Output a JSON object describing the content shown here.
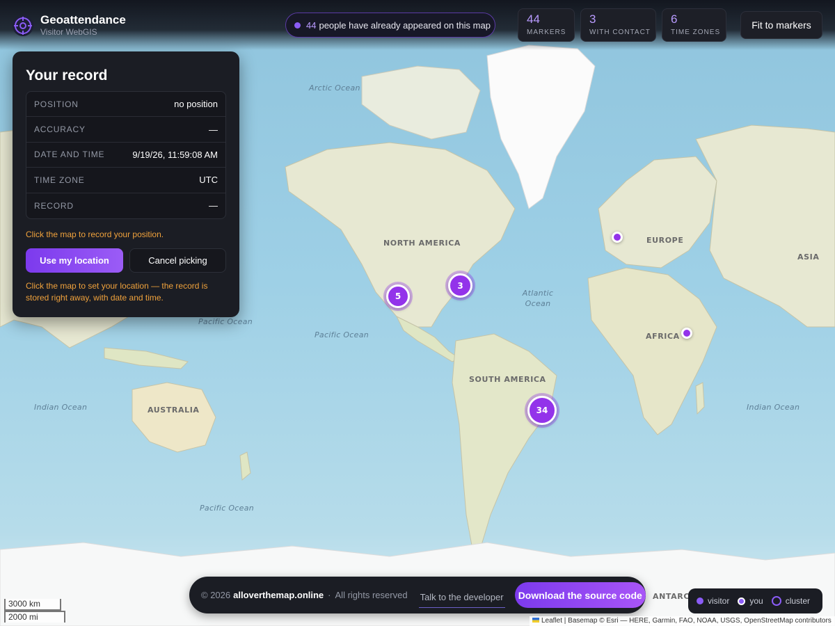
{
  "header": {
    "title": "Geoattendance",
    "subtitle": "Visitor WebGIS",
    "appeared_count": "44",
    "appeared_text": "people have already appeared on this map",
    "stats": [
      {
        "value": "44",
        "label": "MARKERS"
      },
      {
        "value": "3",
        "label": "WITH CONTACT"
      },
      {
        "value": "6",
        "label": "TIME ZONES"
      }
    ],
    "fit_button": "Fit to markers"
  },
  "record_panel": {
    "title": "Your record",
    "rows": [
      {
        "key": "POSITION",
        "value": "no position"
      },
      {
        "key": "ACCURACY",
        "value": "—"
      },
      {
        "key": "DATE AND TIME",
        "value": "9/19/26, 11:59:08 AM"
      },
      {
        "key": "TIME ZONE",
        "value": "UTC"
      },
      {
        "key": "RECORD",
        "value": "—"
      }
    ],
    "hint": "Click the map to record your position.",
    "use_location_button": "Use my location",
    "cancel_button": "Cancel picking",
    "note": "Click the map to set your location — the record is stored right away, with date and time."
  },
  "map": {
    "ocean_labels": [
      "Arctic Ocean",
      "Pacific Ocean",
      "Pacific Ocean",
      "Atlantic Ocean",
      "Indian Ocean",
      "Indian Ocean",
      "Pacific Ocean"
    ],
    "continent_labels": [
      "NORTH AMERICA",
      "EUROPE",
      "ASIA",
      "AFRICA",
      "SOUTH AMERICA",
      "AUSTRALIA",
      "ANTARCTICA"
    ],
    "clusters": [
      {
        "count": "5",
        "region": "Mexico"
      },
      {
        "count": "3",
        "region": "Florida"
      },
      {
        "count": "34",
        "region": "Brazil"
      }
    ],
    "visitors": [
      {
        "region": "United Kingdom"
      },
      {
        "region": "Ethiopia"
      }
    ],
    "scale": {
      "metric": "3000 km",
      "imperial": "2000 mi"
    },
    "attribution": "Leaflet | Basemap © Esri — HERE, Garmin, FAO, NOAA, USGS, OpenStreetMap contributors"
  },
  "footer": {
    "copyright": "© 2026",
    "site": "alloverthemap.online",
    "separator": "·",
    "rights": "All rights reserved",
    "developer_link": "Talk to the developer",
    "download_button": "Download the source code"
  },
  "legend": {
    "visitor": "visitor",
    "you": "you",
    "cluster": "cluster"
  },
  "colors": {
    "accent": "#8b5cf6",
    "marker": "#9333ea",
    "warning_text": "#f0a23c",
    "panel_bg": "#1b1d24"
  },
  "icons": {
    "brand": "globe-target-icon"
  }
}
